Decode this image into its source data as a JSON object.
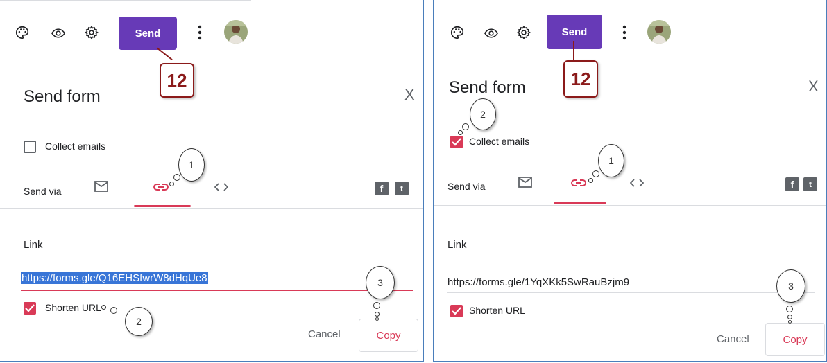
{
  "left": {
    "toolbar": {
      "send_label": "Send"
    },
    "callout_number": "12",
    "dialog": {
      "title": "Send form",
      "close": "X",
      "collect_emails_label": "Collect emails",
      "collect_emails_checked": false,
      "send_via_label": "Send via",
      "link_heading": "Link",
      "link_value": "https://forms.gle/Q16EHSfwrW8dHqUe8",
      "shorten_url_label": "Shorten URL",
      "shorten_url_checked": true,
      "cancel_label": "Cancel",
      "copy_label": "Copy"
    },
    "bubbles": [
      "1",
      "2",
      "3"
    ]
  },
  "right": {
    "toolbar": {
      "send_label": "Send"
    },
    "callout_number": "12",
    "dialog": {
      "title": "Send form",
      "close": "X",
      "collect_emails_label": "Collect emails",
      "collect_emails_checked": true,
      "send_via_label": "Send via",
      "link_heading": "Link",
      "link_value": "https://forms.gle/1YqXKk5SwRauBzjm9",
      "shorten_url_label": "Shorten URL",
      "shorten_url_checked": true,
      "cancel_label": "Cancel",
      "copy_label": "Copy"
    },
    "bubbles": [
      "1",
      "2",
      "3"
    ]
  },
  "icons": [
    "palette-icon",
    "eye-icon",
    "gear-icon",
    "more-vert-icon",
    "mail-icon",
    "link-icon",
    "embed-icon",
    "facebook-icon",
    "twitter-icon"
  ],
  "colors": {
    "send_button": "#673ab7",
    "accent": "#d93a57",
    "callout": "#8b1a1a",
    "selection": "#3875d7"
  }
}
